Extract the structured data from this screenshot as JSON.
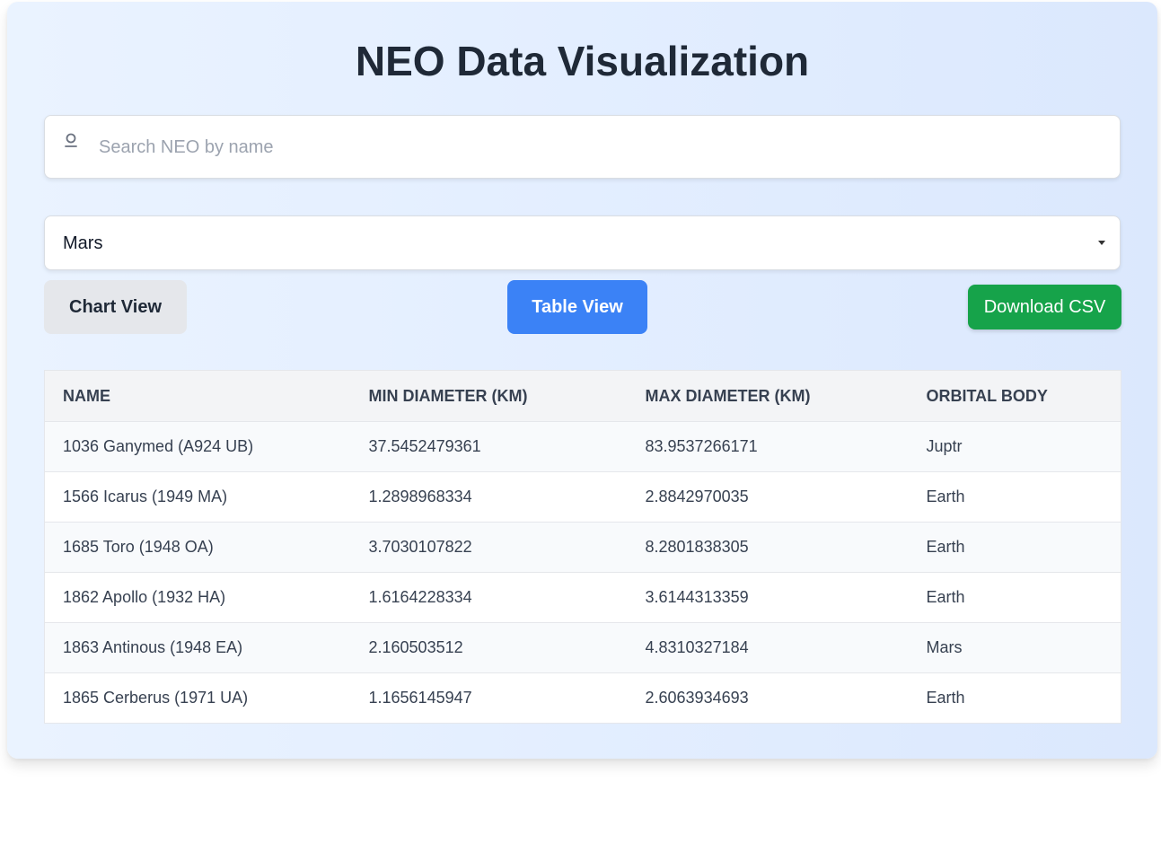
{
  "header": {
    "title": "NEO Data Visualization"
  },
  "search": {
    "placeholder": "Search NEO by name",
    "value": "",
    "icon": "user-icon"
  },
  "filter": {
    "selected": "Mars",
    "icon": "chevron-down-icon"
  },
  "buttons": {
    "chart_view": "Chart View",
    "table_view": "Table View",
    "download_csv": "Download CSV"
  },
  "colors": {
    "primary": "#3b82f6",
    "success": "#16a34a",
    "neutral": "#e5e7eb",
    "title": "#1f2937"
  },
  "table": {
    "columns": [
      "Name",
      "Min Diameter (km)",
      "Max Diameter (km)",
      "Orbital Body"
    ],
    "rows": [
      [
        "1036 Ganymed (A924 UB)",
        "37.5452479361",
        "83.9537266171",
        "Juptr"
      ],
      [
        "1566 Icarus (1949 MA)",
        "1.2898968334",
        "2.8842970035",
        "Earth"
      ],
      [
        "1685 Toro (1948 OA)",
        "3.7030107822",
        "8.2801838305",
        "Earth"
      ],
      [
        "1862 Apollo (1932 HA)",
        "1.6164228334",
        "3.6144313359",
        "Earth"
      ],
      [
        "1863 Antinous (1948 EA)",
        "2.160503512",
        "4.8310327184",
        "Mars"
      ],
      [
        "1865 Cerberus (1971 UA)",
        "1.1656145947",
        "2.6063934693",
        "Earth"
      ]
    ]
  }
}
